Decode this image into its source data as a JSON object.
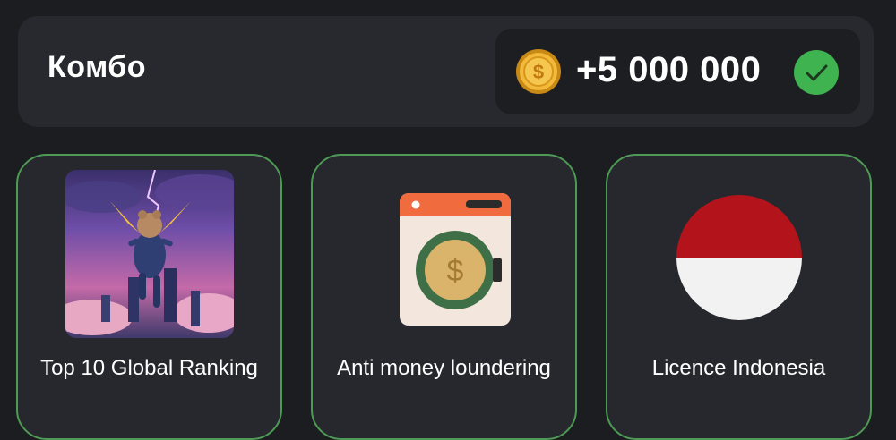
{
  "combo": {
    "title": "Комбо",
    "reward": "+5 000 000",
    "coin_icon": "dollar-coin-icon",
    "status_icon": "check-icon"
  },
  "cards": [
    {
      "label": "Top 10 Global Ranking",
      "icon": "hamster-astronaut-image"
    },
    {
      "label": "Anti money loundering",
      "icon": "washing-machine-coin-icon"
    },
    {
      "label": "Licence Indonesia",
      "icon": "indonesia-flag-icon"
    }
  ],
  "colors": {
    "background": "#1c1d21",
    "panel": "#27292e",
    "card_border": "#4e9a55",
    "coin": "#f2b93b",
    "check": "#3fb34f",
    "flag_red": "#b3131b",
    "flag_white": "#f2f2f2"
  }
}
